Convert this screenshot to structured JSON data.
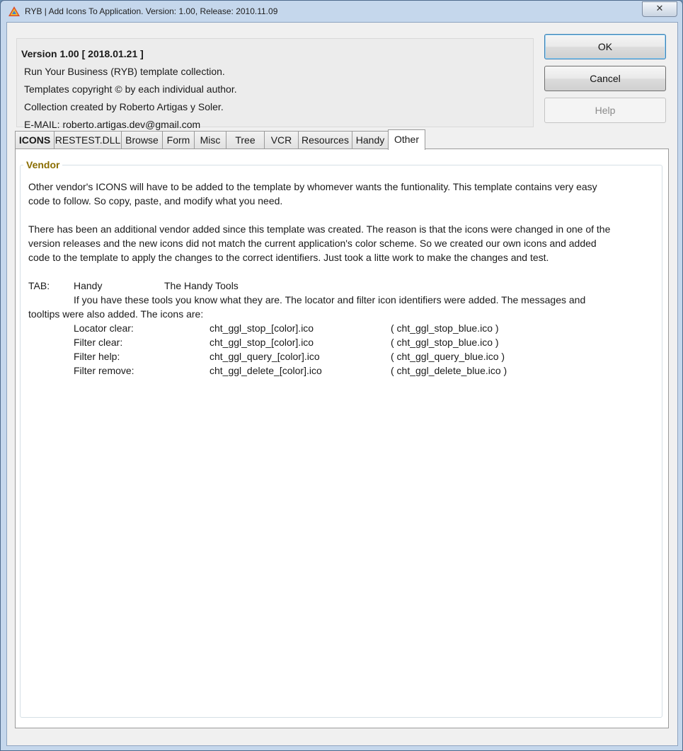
{
  "window": {
    "title": "RYB | Add Icons To Application. Version: 1.00, Release: 2010.11.09",
    "close_glyph": "✕"
  },
  "info": {
    "version": "Version 1.00 [ 2018.01.21 ]",
    "line1": "Run Your Business (RYB) template collection.",
    "line2": "Templates copyright © by each individual author.",
    "line3": "Collection created by Roberto Artigas y Soler.",
    "line4": "E-MAIL: roberto.artigas.dev@gmail.com"
  },
  "buttons": {
    "ok": "OK",
    "cancel": "Cancel",
    "help": "Help"
  },
  "tabs": [
    {
      "label": "ICONS"
    },
    {
      "label": "RESTEST.DLL"
    },
    {
      "label": "Browse"
    },
    {
      "label": "Form"
    },
    {
      "label": "Misc"
    },
    {
      "label": "Tree"
    },
    {
      "label": "VCR"
    },
    {
      "label": "Resources"
    },
    {
      "label": "Handy"
    },
    {
      "label": "Other"
    }
  ],
  "active_tab": "Other",
  "group": {
    "label": "Vendor",
    "para1_line1": "Other vendor's ICONS will have to be added to the template by whomever wants the funtionality. This template contains very easy",
    "para1_line2": "code to follow. So copy, paste, and modify what you need.",
    "para2_line1": "There has been an additional vendor added since this template was created. The reason is that the icons were changed in one of the",
    "para2_line2": "version releases and the new icons did not match the current application's color scheme. So we created our own icons and added",
    "para2_line3": "code to the template to apply the changes to the correct identifiers. Just took a litte work to make the changes and test.",
    "tab_label": "TAB:",
    "tab_name": "Handy",
    "tab_desc": "The Handy Tools",
    "desc_line1": "If you have these tools you know what they are. The locator and filter icon identifiers were added. The messages and",
    "desc_line2": "tooltips were also added. The icons are:",
    "icons": [
      {
        "name": "Locator clear:",
        "pattern": "cht_ggl_stop_[color].ico",
        "example": "( cht_ggl_stop_blue.ico )"
      },
      {
        "name": "Filter clear:",
        "pattern": "cht_ggl_stop_[color].ico",
        "example": "( cht_ggl_stop_blue.ico )"
      },
      {
        "name": "Filter help:",
        "pattern": "cht_ggl_query_[color].ico",
        "example": "( cht_ggl_query_blue.ico )"
      },
      {
        "name": "Filter remove:",
        "pattern": "cht_ggl_delete_[color].ico",
        "example": "( cht_ggl_delete_blue.ico )"
      }
    ]
  },
  "colors": {
    "group_label": "#8a6d00",
    "window_frame": "#c5d7ec",
    "default_button_border": "#3c7fb1"
  }
}
